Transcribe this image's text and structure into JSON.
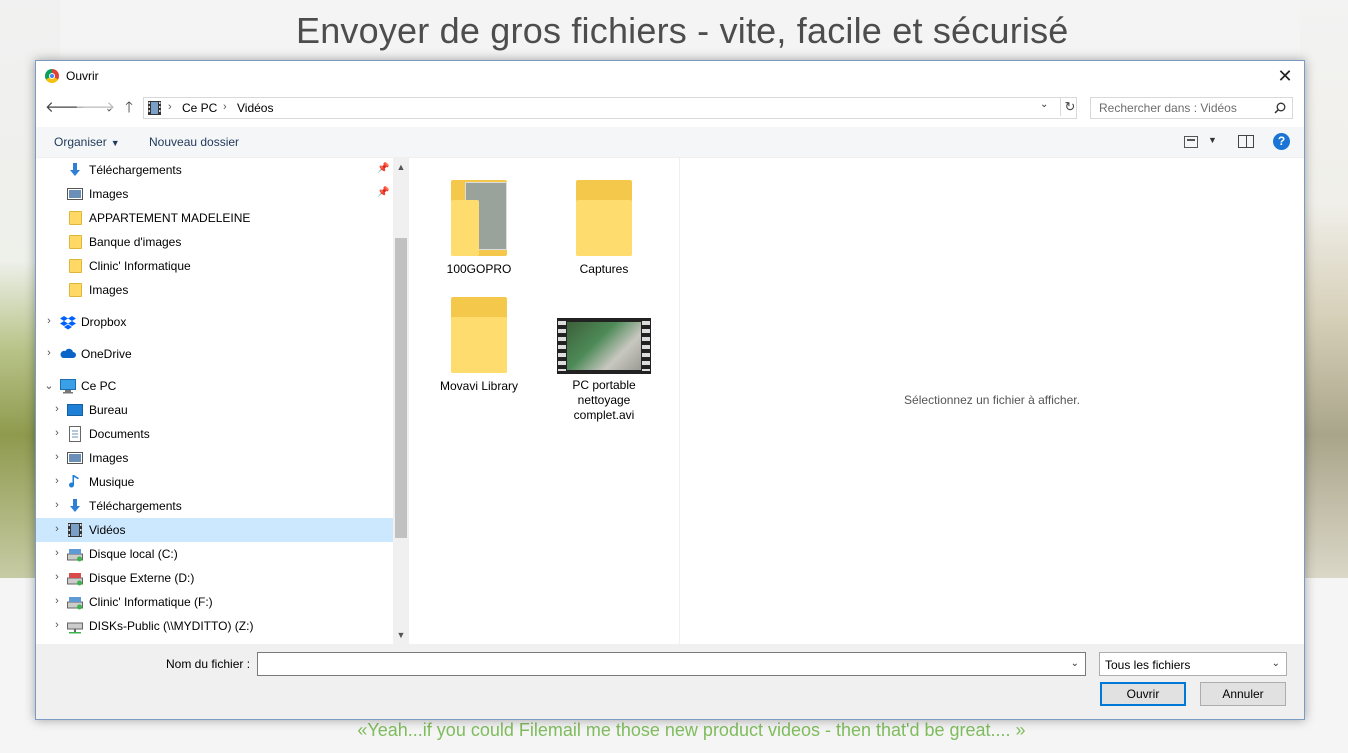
{
  "website": {
    "title": "Envoyer de gros fichiers - vite, facile et sécurisé",
    "quote": "«Yeah...if you could Filemail me those new product videos - then that'd be great.... »"
  },
  "dialog": {
    "title": "Ouvrir",
    "breadcrumb": [
      "Ce PC",
      "Vidéos"
    ],
    "search_placeholder": "Rechercher dans : Vidéos",
    "toolbar": {
      "organize": "Organiser",
      "new_folder": "Nouveau dossier"
    },
    "nav": [
      {
        "label": "Téléchargements",
        "icon": "download-icon",
        "pinned": true
      },
      {
        "label": "Images",
        "icon": "pictures-icon",
        "pinned": true
      },
      {
        "label": "APPARTEMENT MADELEINE",
        "icon": "folder-icon"
      },
      {
        "label": "Banque d'images",
        "icon": "folder-icon"
      },
      {
        "label": "Clinic' Informatique",
        "icon": "folder-icon"
      },
      {
        "label": "Images",
        "icon": "folder-icon"
      },
      {
        "label": "Dropbox",
        "icon": "dropbox-icon"
      },
      {
        "label": "OneDrive",
        "icon": "onedrive-icon"
      },
      {
        "label": "Ce PC",
        "icon": "computer-icon"
      },
      {
        "label": "Bureau",
        "icon": "desktop-icon"
      },
      {
        "label": "Documents",
        "icon": "documents-icon"
      },
      {
        "label": "Images",
        "icon": "pictures-icon"
      },
      {
        "label": "Musique",
        "icon": "music-icon"
      },
      {
        "label": "Téléchargements",
        "icon": "download-icon"
      },
      {
        "label": "Vidéos",
        "icon": "videos-icon",
        "selected": true
      },
      {
        "label": "Disque local (C:)",
        "icon": "drive-icon"
      },
      {
        "label": "Disque Externe (D:)",
        "icon": "drive-icon"
      },
      {
        "label": "Clinic' Informatique (F:)",
        "icon": "drive-icon"
      },
      {
        "label": "DISKs-Public (\\\\MYDITTO) (Z:)",
        "icon": "network-drive-icon"
      }
    ],
    "files": [
      {
        "name": "100GOPRO",
        "type": "folder"
      },
      {
        "name": "Captures",
        "type": "folder"
      },
      {
        "name": "Movavi Library",
        "type": "folder"
      },
      {
        "name": "PC portable nettoyage complet.avi",
        "type": "video",
        "lines": [
          "PC portable",
          "nettoyage",
          "complet.avi"
        ]
      }
    ],
    "preview_text": "Sélectionnez un fichier à afficher.",
    "filename_label": "Nom du fichier :",
    "filename_value": "",
    "file_type": "Tous les fichiers",
    "open_button": "Ouvrir",
    "cancel_button": "Annuler"
  },
  "colors": {
    "selection": "#cce8ff",
    "folder": "#ffd865",
    "accent": "#0078d7",
    "quote": "#7fbd5d"
  }
}
